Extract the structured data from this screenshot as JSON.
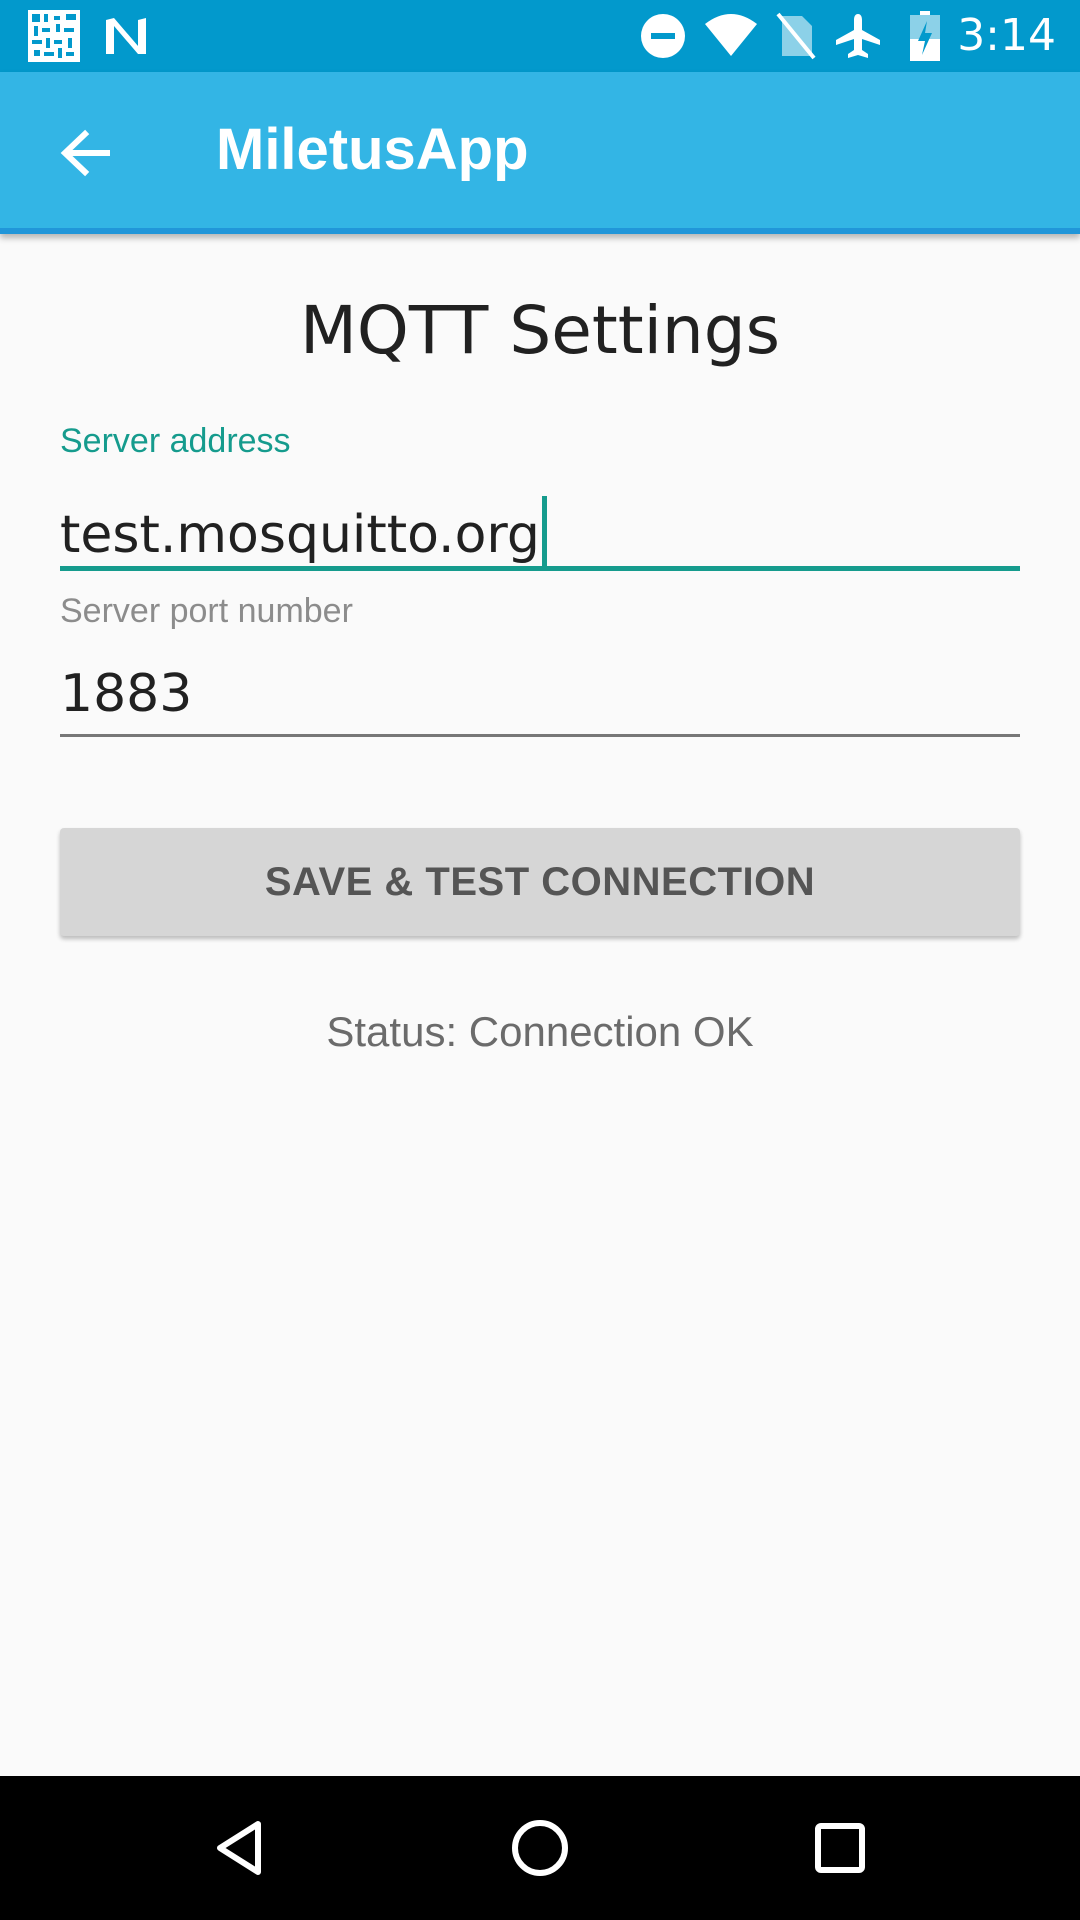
{
  "status_bar": {
    "time": "3:14",
    "icons": [
      "qr-code-icon",
      "n-badge-icon",
      "do-not-disturb-icon",
      "wifi-icon",
      "no-sim-icon",
      "airplane-icon",
      "battery-charging-icon"
    ]
  },
  "app_bar": {
    "title": "MiletusApp",
    "back_icon": "arrow-back-icon",
    "color": "#33b5e5"
  },
  "main": {
    "heading": "MQTT Settings",
    "server_address": {
      "label": "Server address",
      "value": "test.mosquitto.org",
      "focused": true
    },
    "server_port": {
      "label": "Server port number",
      "value": "1883"
    },
    "action_button_label": "SAVE & TEST CONNECTION",
    "status": "Status: Connection OK",
    "accent_color": "#159b8d"
  },
  "nav_bar": {
    "icons": [
      "back-triangle-icon",
      "home-circle-icon",
      "recents-square-icon"
    ]
  }
}
